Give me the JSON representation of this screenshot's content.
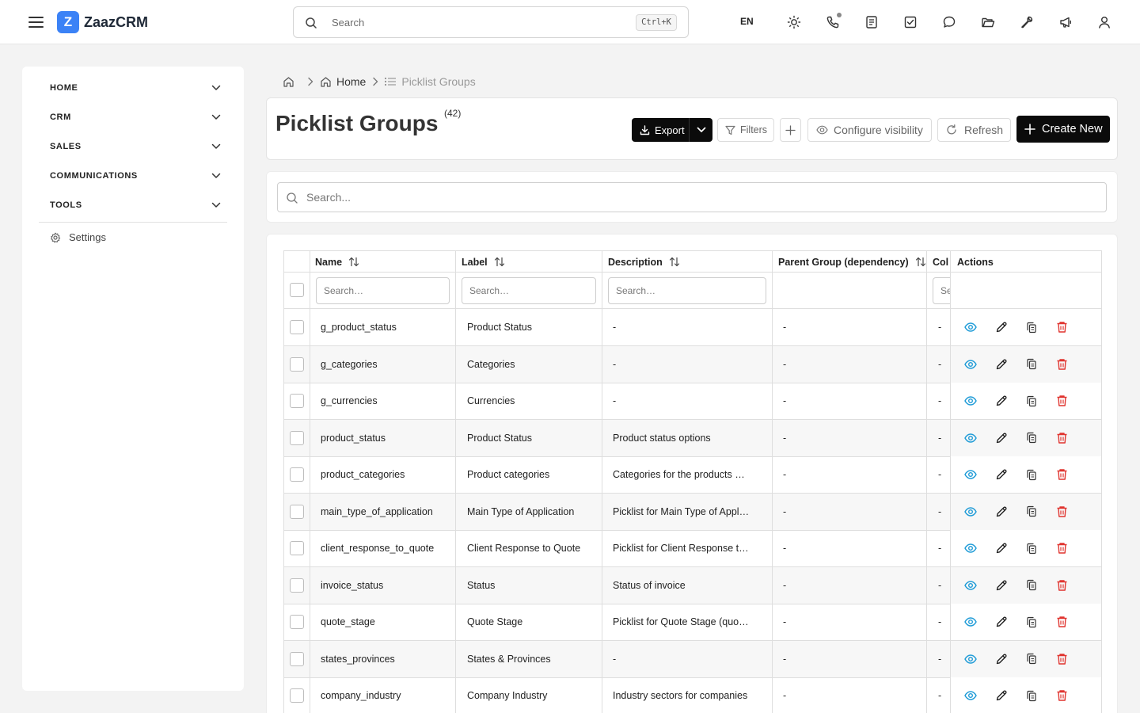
{
  "app": {
    "name": "ZaazCRM",
    "logo_letter": "Z",
    "accent": "#3b82f6"
  },
  "topbar": {
    "search_placeholder": "Search",
    "search_shortcut": "Ctrl+K",
    "language": "EN",
    "icons": [
      "sun-icon",
      "phone-icon",
      "document-icon",
      "checkbox-icon",
      "chat-icon",
      "folder-icon",
      "wrench-icon",
      "megaphone-icon",
      "user-icon"
    ]
  },
  "sidebar": {
    "items": [
      {
        "label": "HOME"
      },
      {
        "label": "CRM"
      },
      {
        "label": "SALES"
      },
      {
        "label": "COMMUNICATIONS"
      },
      {
        "label": "TOOLS"
      }
    ],
    "settings_label": "Settings"
  },
  "breadcrumb": {
    "home": "Home",
    "current": "Picklist Groups"
  },
  "header": {
    "title": "Picklist Groups",
    "count": "(42)",
    "export_label": "Export",
    "filters_label": "Filters",
    "visibility_label": "Configure visibility",
    "refresh_label": "Refresh",
    "create_label": "Create New"
  },
  "search": {
    "placeholder": "Search..."
  },
  "table": {
    "columns": {
      "name": "Name",
      "label": "Label",
      "description": "Description",
      "parent": "Parent Group (dependency)",
      "color": "Col",
      "actions": "Actions"
    },
    "filter_placeholder": "Search…",
    "filter_placeholder_short": "Se",
    "rows": [
      {
        "name": "g_product_status",
        "label": "Product Status",
        "description": "-",
        "parent": "-",
        "color": "-"
      },
      {
        "name": "g_categories",
        "label": "Categories",
        "description": "-",
        "parent": "-",
        "color": "-"
      },
      {
        "name": "g_currencies",
        "label": "Currencies",
        "description": "-",
        "parent": "-",
        "color": "-"
      },
      {
        "name": "product_status",
        "label": "Product Status",
        "description": "Product status options",
        "parent": "-",
        "color": "-"
      },
      {
        "name": "product_categories",
        "label": "Product categories",
        "description": "Categories for the products …",
        "parent": "-",
        "color": "-"
      },
      {
        "name": "main_type_of_application",
        "label": "Main Type of Application",
        "description": "Picklist for Main Type of Appl…",
        "parent": "-",
        "color": "-"
      },
      {
        "name": "client_response_to_quote",
        "label": "Client Response to Quote",
        "description": "Picklist for Client Response t…",
        "parent": "-",
        "color": "-"
      },
      {
        "name": "invoice_status",
        "label": "Status",
        "description": "Status of invoice",
        "parent": "-",
        "color": "-"
      },
      {
        "name": "quote_stage",
        "label": "Quote Stage",
        "description": "Picklist for Quote Stage (quo…",
        "parent": "-",
        "color": "-"
      },
      {
        "name": "states_provinces",
        "label": "States & Provinces",
        "description": "-",
        "parent": "-",
        "color": "-"
      },
      {
        "name": "company_industry",
        "label": "Company Industry",
        "description": "Industry sectors for companies",
        "parent": "-",
        "color": "-"
      }
    ]
  },
  "colors": {
    "view": "#1e9bd7",
    "delete": "#e0342f",
    "primary_button": "#0b0b0b"
  }
}
